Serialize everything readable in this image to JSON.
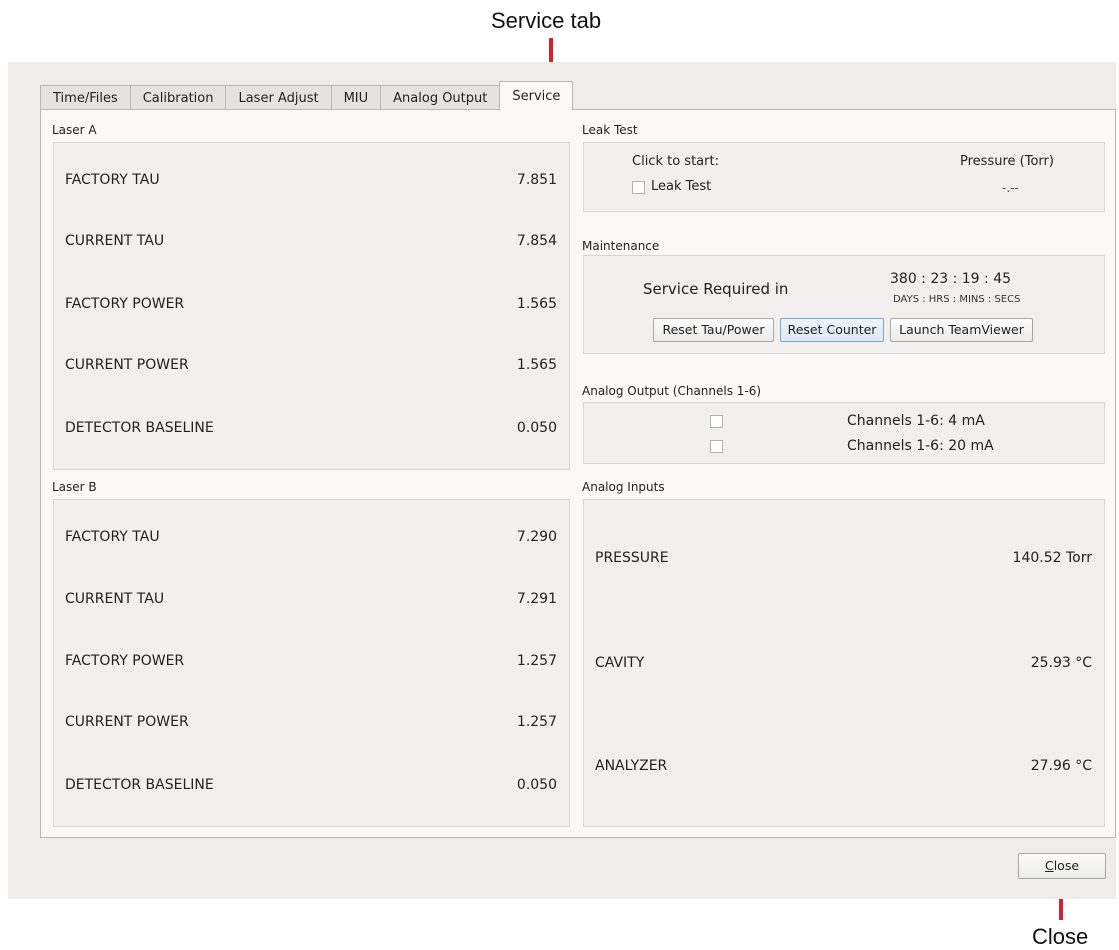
{
  "annotations": {
    "service_tab": "Service tab",
    "close": "Close"
  },
  "tabs": [
    {
      "label": "Time/Files",
      "active": false
    },
    {
      "label": "Calibration",
      "active": false
    },
    {
      "label": "Laser Adjust",
      "active": false
    },
    {
      "label": "MIU",
      "active": false
    },
    {
      "label": "Analog Output",
      "active": false
    },
    {
      "label": "Service",
      "active": true
    }
  ],
  "laser_a": {
    "title": "Laser A",
    "rows": [
      {
        "label": "FACTORY TAU",
        "value": "7.851"
      },
      {
        "label": "CURRENT TAU",
        "value": "7.854"
      },
      {
        "label": "FACTORY POWER",
        "value": "1.565"
      },
      {
        "label": "CURRENT POWER",
        "value": "1.565"
      },
      {
        "label": "DETECTOR BASELINE",
        "value": "0.050"
      }
    ]
  },
  "laser_b": {
    "title": "Laser B",
    "rows": [
      {
        "label": "FACTORY TAU",
        "value": "7.290"
      },
      {
        "label": "CURRENT TAU",
        "value": "7.291"
      },
      {
        "label": "FACTORY POWER",
        "value": "1.257"
      },
      {
        "label": "CURRENT POWER",
        "value": "1.257"
      },
      {
        "label": "DETECTOR BASELINE",
        "value": "0.050"
      }
    ]
  },
  "leak_test": {
    "title": "Leak Test",
    "click_to_start": "Click to start:",
    "checkbox_label": "Leak Test",
    "pressure_header": "Pressure (Torr)",
    "pressure_value": "-.--"
  },
  "maintenance": {
    "title": "Maintenance",
    "service_required": "Service Required in",
    "countdown": "380 : 23 : 19 : 45",
    "units": "DAYS : HRS : MINS : SECS",
    "reset_tau_power": "Reset Tau/Power",
    "reset_counter": "Reset Counter",
    "launch_teamviewer": "Launch TeamViewer"
  },
  "analog_output": {
    "title": "Analog Output (Channels 1-6)",
    "options": [
      {
        "label": "Channels 1-6: 4 mA",
        "checked": false
      },
      {
        "label": "Channels 1-6: 20 mA",
        "checked": false
      }
    ]
  },
  "analog_inputs": {
    "title": "Analog Inputs",
    "rows": [
      {
        "label": "PRESSURE",
        "value": "140.52 Torr"
      },
      {
        "label": "CAVITY",
        "value": "25.93 °C"
      },
      {
        "label": "ANALYZER",
        "value": "27.96 °C"
      }
    ]
  },
  "footer": {
    "close_prefix": "",
    "close_mnemonic": "C",
    "close_rest": "lose"
  }
}
